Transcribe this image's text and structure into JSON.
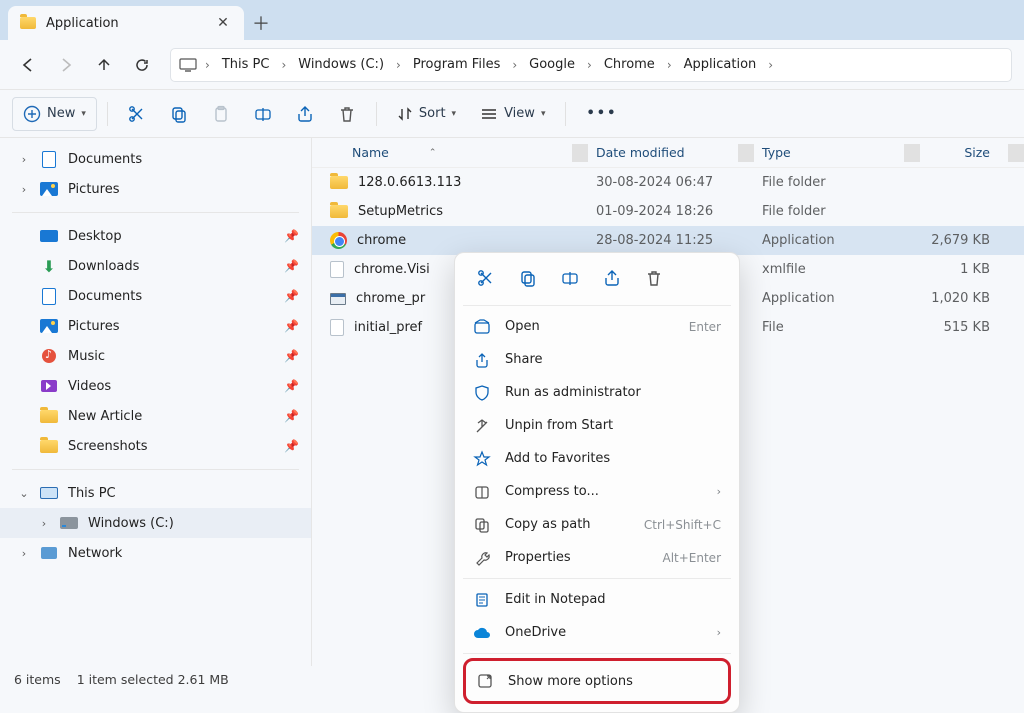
{
  "tab": {
    "title": "Application"
  },
  "breadcrumbs": [
    "This PC",
    "Windows (C:)",
    "Program Files",
    "Google",
    "Chrome",
    "Application"
  ],
  "toolbar": {
    "new": "New",
    "sort": "Sort",
    "view": "View"
  },
  "sidebar": {
    "top": [
      {
        "label": "Documents",
        "icon": "doc",
        "chev": true
      },
      {
        "label": "Pictures",
        "icon": "pic",
        "chev": true
      }
    ],
    "pinned": [
      {
        "label": "Desktop",
        "icon": "desktop"
      },
      {
        "label": "Downloads",
        "icon": "dl"
      },
      {
        "label": "Documents",
        "icon": "doc"
      },
      {
        "label": "Pictures",
        "icon": "pic"
      },
      {
        "label": "Music",
        "icon": "music"
      },
      {
        "label": "Videos",
        "icon": "vid"
      },
      {
        "label": "New Article",
        "icon": "folder"
      },
      {
        "label": "Screenshots",
        "icon": "folder"
      }
    ],
    "bottom": [
      {
        "label": "This PC",
        "icon": "pc",
        "chev": "open"
      },
      {
        "label": "Windows (C:)",
        "icon": "drive",
        "indent": true,
        "chev": true,
        "selected": true
      },
      {
        "label": "Network",
        "icon": "net",
        "chev": true
      }
    ]
  },
  "columns": {
    "name": "Name",
    "date": "Date modified",
    "type": "Type",
    "size": "Size"
  },
  "files": [
    {
      "name": "128.0.6613.113",
      "icon": "folder",
      "date": "30-08-2024 06:47",
      "type": "File folder",
      "size": ""
    },
    {
      "name": "SetupMetrics",
      "icon": "folder",
      "date": "01-09-2024 18:26",
      "type": "File folder",
      "size": ""
    },
    {
      "name": "chrome",
      "icon": "chrome",
      "date": "28-08-2024 11:25",
      "type": "Application",
      "size": "2,679 KB",
      "selected": true
    },
    {
      "name": "chrome.Visi",
      "icon": "file",
      "date": "",
      "type": "xmlfile",
      "size": "1 KB"
    },
    {
      "name": "chrome_pr",
      "icon": "exe",
      "date": "",
      "type": "Application",
      "size": "1,020 KB"
    },
    {
      "name": "initial_pref",
      "icon": "file",
      "date": "",
      "type": "File",
      "size": "515 KB"
    }
  ],
  "context_menu": {
    "open": "Open",
    "open_hint": "Enter",
    "share": "Share",
    "runas": "Run as administrator",
    "unpin": "Unpin from Start",
    "fav": "Add to Favorites",
    "compress": "Compress to...",
    "copypath": "Copy as path",
    "copypath_hint": "Ctrl+Shift+C",
    "props": "Properties",
    "props_hint": "Alt+Enter",
    "notepad": "Edit in Notepad",
    "onedrive": "OneDrive",
    "more": "Show more options"
  },
  "status": {
    "count": "6 items",
    "selection": "1 item selected  2.61 MB"
  }
}
